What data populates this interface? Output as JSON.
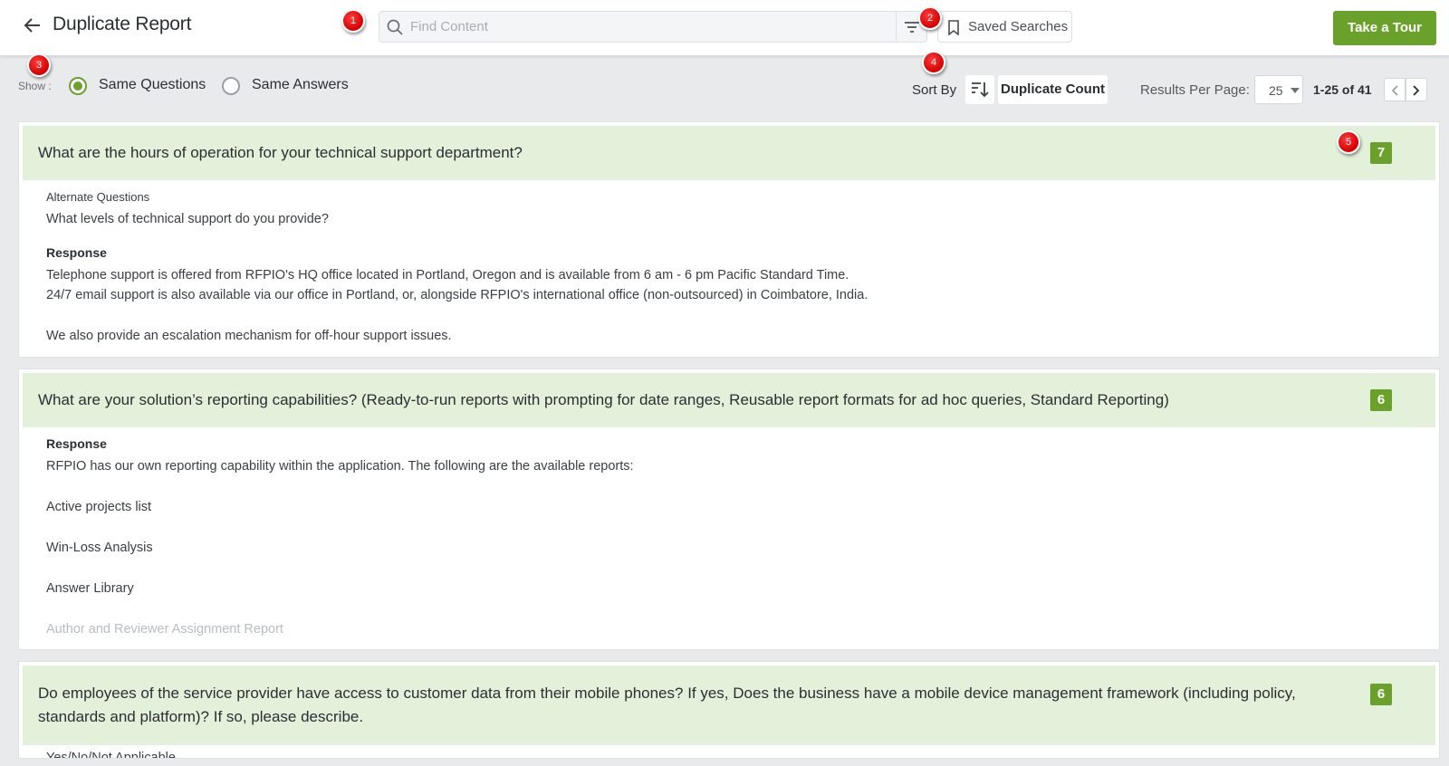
{
  "header": {
    "title": "Duplicate Report",
    "search_placeholder": "Find Content",
    "saved_searches_label": "Saved Searches",
    "tour_label": "Take a Tour"
  },
  "toolbar": {
    "show_label": "Show :",
    "options": [
      {
        "label": "Same Questions",
        "checked": true
      },
      {
        "label": "Same Answers",
        "checked": false
      }
    ],
    "sort_by_label": "Sort By",
    "sort_field": "Duplicate Count",
    "results_per_page_label": "Results Per Page:",
    "results_per_page_value": "25",
    "page_range": "1-25 of 41"
  },
  "markers": [
    "1",
    "2",
    "3",
    "4",
    "5"
  ],
  "colors": {
    "accent": "#6aa12b",
    "card_header": "#e3f0da",
    "marker": "#d40000"
  },
  "cards": [
    {
      "question": "What are the hours of operation for your technical support department?",
      "count": "7",
      "alternate_label": "Alternate Questions",
      "alternate_question": "What levels of technical support do you provide?",
      "response_label": "Response",
      "response_lines": [
        "Telephone support is offered from RFPIO's HQ office located in Portland, Oregon and is available from 6 am - 6 pm Pacific Standard Time.",
        "24/7 email support is also available via our office in Portland, or, alongside RFPIO's international office (non-outsourced) in Coimbatore, India.",
        "We also provide an escalation mechanism for off-hour support issues."
      ]
    },
    {
      "question": "What are your solution’s reporting capabilities? (Ready-to-run reports with prompting for date ranges, Reusable report formats for ad hoc queries, Standard Reporting)",
      "count": "6",
      "response_label": "Response",
      "response_lines": [
        "RFPIO has our own reporting capability within the application. The following are the available reports:",
        "Active projects list",
        "Win-Loss Analysis",
        "Answer Library",
        "Author and Reviewer Assignment Report"
      ]
    },
    {
      "question_line1": "Do employees of the service provider have access to customer data from their mobile phones? If yes, Does the business have a mobile device management framework (including policy,",
      "question_line2": "standards and platform)? If so, please describe.",
      "count": "6",
      "response_first": "Yes/No/Not Applicable"
    }
  ]
}
